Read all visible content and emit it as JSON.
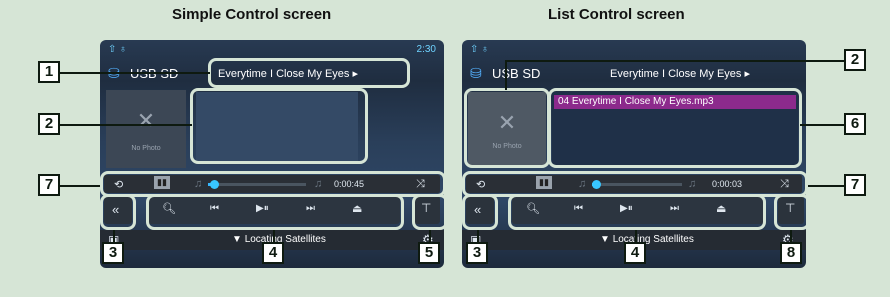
{
  "headings": {
    "simple": "Simple Control screen",
    "list": "List Control screen"
  },
  "status": {
    "time": "2:30"
  },
  "source_label": "USB SD",
  "track_title": "Everytime I Close My Eyes",
  "track_title_list": "Everytime I Close My Eyes",
  "list_item": "04 Everytime I Close My Eyes.mp3",
  "no_photo": "No Photo",
  "simple_elapsed": "0:00:45",
  "list_elapsed": "0:00:03",
  "simple_progress": 0.06,
  "list_progress": 0.03,
  "nav_status": "Locating Satellites",
  "callouts": {
    "simple": [
      "1",
      "2",
      "7",
      "3",
      "4",
      "5"
    ],
    "list": [
      "2",
      "6",
      "7",
      "3",
      "4",
      "8"
    ]
  },
  "icons": [
    "search-icon",
    "prev-track-icon",
    "play-pause-icon",
    "next-track-icon",
    "eject-icon",
    "repeat-icon",
    "shuffle-icon",
    "collapse-icon",
    "text-scroll-icon",
    "usb-icon",
    "settings-icon"
  ]
}
